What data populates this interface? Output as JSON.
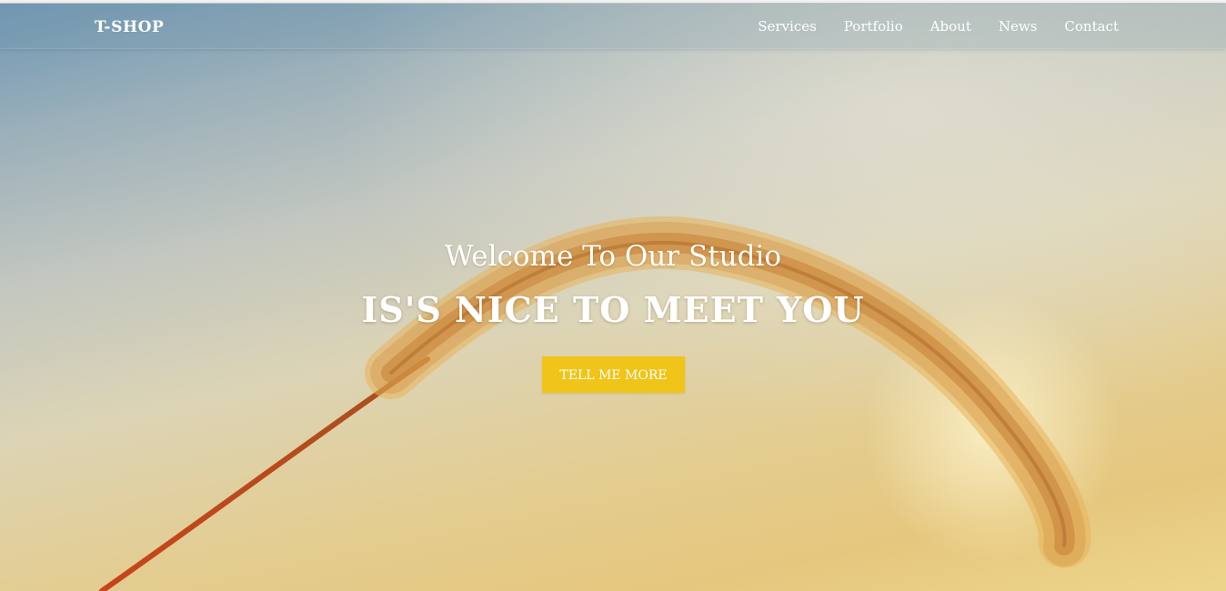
{
  "header": {
    "brand": "T-SHOP",
    "nav": [
      "Services",
      "Portfolio",
      "About",
      "News",
      "Contact"
    ]
  },
  "hero": {
    "subtitle": "Welcome To Our Studio",
    "headline": "IS'S NICE TO MEET YOU",
    "cta_label": "TELL ME MORE"
  },
  "colors": {
    "accent": "#f0c419",
    "text": "#ffffff"
  }
}
